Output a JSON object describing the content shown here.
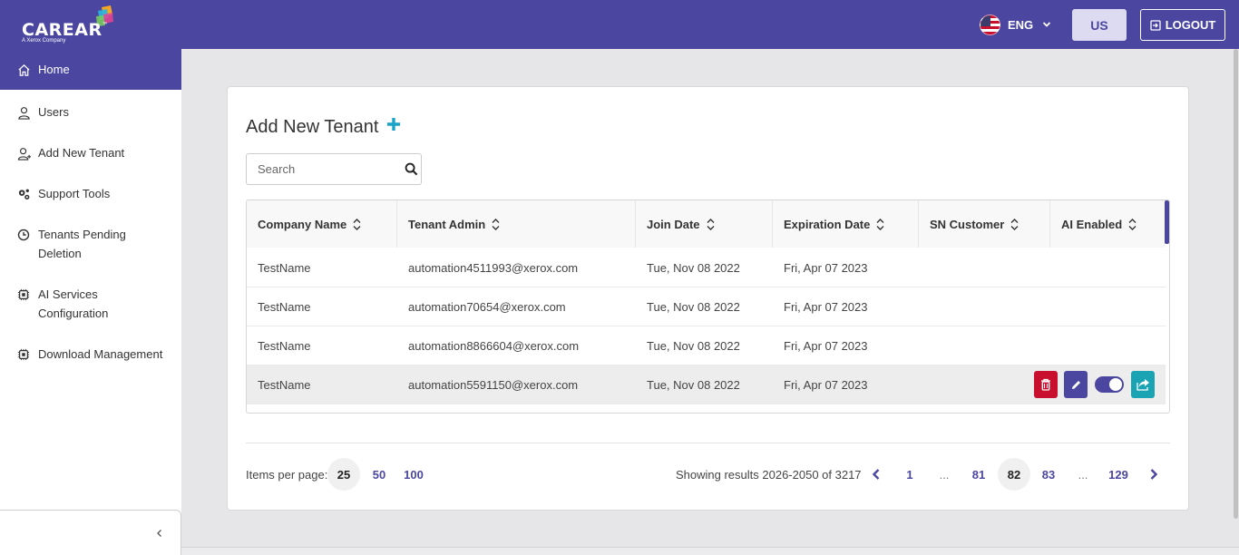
{
  "header": {
    "logo_text": "CAREAR",
    "logo_tm": "™",
    "logo_sub": "A Xerox Company",
    "language": "ENG",
    "region_button": "US",
    "logout_label": "LOGOUT",
    "colors": {
      "brand": "#4b47a0",
      "accent": "#1aa3c8"
    }
  },
  "sidebar": {
    "items": [
      {
        "label": "Home",
        "icon": "home-icon",
        "active": true
      },
      {
        "label": "Users",
        "icon": "user-icon"
      },
      {
        "label": "Add New Tenant",
        "icon": "add-user-icon"
      },
      {
        "label": "Support Tools",
        "icon": "gears-icon"
      },
      {
        "label": "Tenants Pending Deletion",
        "icon": "clock-icon"
      },
      {
        "label": "AI Services Configuration",
        "icon": "chip-icon"
      },
      {
        "label": "Download Management",
        "icon": "chip-icon"
      }
    ],
    "collapse_icon": "chevron-left-icon"
  },
  "main": {
    "title": "Add New Tenant",
    "search": {
      "placeholder": "Search",
      "value": ""
    },
    "table": {
      "columns": [
        "Company Name",
        "Tenant Admin",
        "Join Date",
        "Expiration Date",
        "SN Customer",
        "AI Enabled"
      ],
      "rows": [
        {
          "company": "TestName",
          "admin": "automation4511993@xerox.com",
          "join": "Tue, Nov 08 2022",
          "expiration": "Fri, Apr 07 2023",
          "sn": "",
          "ai": ""
        },
        {
          "company": "TestName",
          "admin": "automation70654@xerox.com",
          "join": "Tue, Nov 08 2022",
          "expiration": "Fri, Apr 07 2023",
          "sn": "",
          "ai": ""
        },
        {
          "company": "TestName",
          "admin": "automation8866604@xerox.com",
          "join": "Tue, Nov 08 2022",
          "expiration": "Fri, Apr 07 2023",
          "sn": "",
          "ai": ""
        },
        {
          "company": "TestName",
          "admin": "automation5591150@xerox.com",
          "join": "Tue, Nov 08 2022",
          "expiration": "Fri, Apr 07 2023",
          "sn": "",
          "ai": ""
        }
      ],
      "row_actions": [
        "delete",
        "edit",
        "toggle-enabled",
        "share"
      ],
      "toggle_on": true
    },
    "pagination": {
      "items_per_page_label": "Items per page:",
      "page_sizes": [
        "25",
        "50",
        "100"
      ],
      "selected_page_size": "25",
      "showing_text": "Showing results 2026-2050 of 3217",
      "pages": [
        "1",
        "...",
        "81",
        "82",
        "83",
        "...",
        "129"
      ],
      "current_page": "82"
    }
  }
}
